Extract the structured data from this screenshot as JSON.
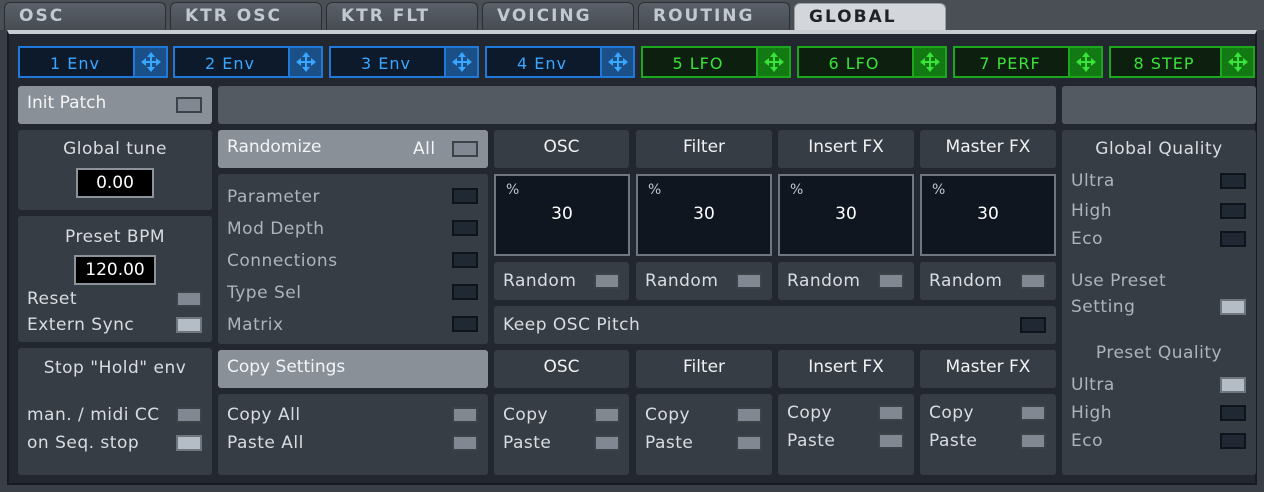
{
  "tabs": [
    "OSC",
    "KTR OSC",
    "KTR FLT",
    "VOICING",
    "ROUTING",
    "GLOBAL"
  ],
  "modulators": [
    {
      "label": "1 Env",
      "color": "blue"
    },
    {
      "label": "2 Env",
      "color": "blue"
    },
    {
      "label": "3 Env",
      "color": "blue"
    },
    {
      "label": "4 Env",
      "color": "blue"
    },
    {
      "label": "5 LFO",
      "color": "green"
    },
    {
      "label": "6 LFO",
      "color": "green"
    },
    {
      "label": "7 PERF",
      "color": "green"
    },
    {
      "label": "8 STEP",
      "color": "green"
    }
  ],
  "init_patch": "Init Patch",
  "global_tune": {
    "title": "Global tune",
    "value": "0.00"
  },
  "preset_bpm": {
    "title": "Preset BPM",
    "value": "120.00",
    "reset": "Reset",
    "extern_sync": "Extern Sync"
  },
  "stop_hold": {
    "title": "Stop \"Hold\" env",
    "option1": "man. / midi CC",
    "option2": "on Seq. stop"
  },
  "randomize": {
    "title": "Randomize",
    "all": "All",
    "items": [
      "Parameter",
      "Mod Depth",
      "Connections",
      "Type Sel",
      "Matrix"
    ]
  },
  "random_sections": [
    {
      "title": "OSC",
      "pct": "%",
      "value": "30",
      "random": "Random"
    },
    {
      "title": "Filter",
      "pct": "%",
      "value": "30",
      "random": "Random"
    },
    {
      "title": "Insert FX",
      "pct": "%",
      "value": "30",
      "random": "Random"
    },
    {
      "title": "Master FX",
      "pct": "%",
      "value": "30",
      "random": "Random"
    }
  ],
  "keep_osc_pitch": "Keep OSC Pitch",
  "copy_settings": {
    "title": "Copy Settings",
    "copy_all": "Copy All",
    "paste_all": "Paste All"
  },
  "copy_sections": [
    {
      "title": "OSC",
      "copy": "Copy",
      "paste": "Paste"
    },
    {
      "title": "Filter",
      "copy": "Copy",
      "paste": "Paste"
    },
    {
      "title": "Insert FX",
      "copy": "Copy",
      "paste": "Paste"
    },
    {
      "title": "Master FX",
      "copy": "Copy",
      "paste": "Paste"
    }
  ],
  "global_quality": {
    "title": "Global Quality",
    "ultra": "Ultra",
    "high": "High",
    "eco": "Eco",
    "use_preset_1": "Use Preset",
    "use_preset_2": "Setting"
  },
  "preset_quality": {
    "title": "Preset Quality",
    "ultra": "Ultra",
    "high": "High",
    "eco": "Eco"
  }
}
